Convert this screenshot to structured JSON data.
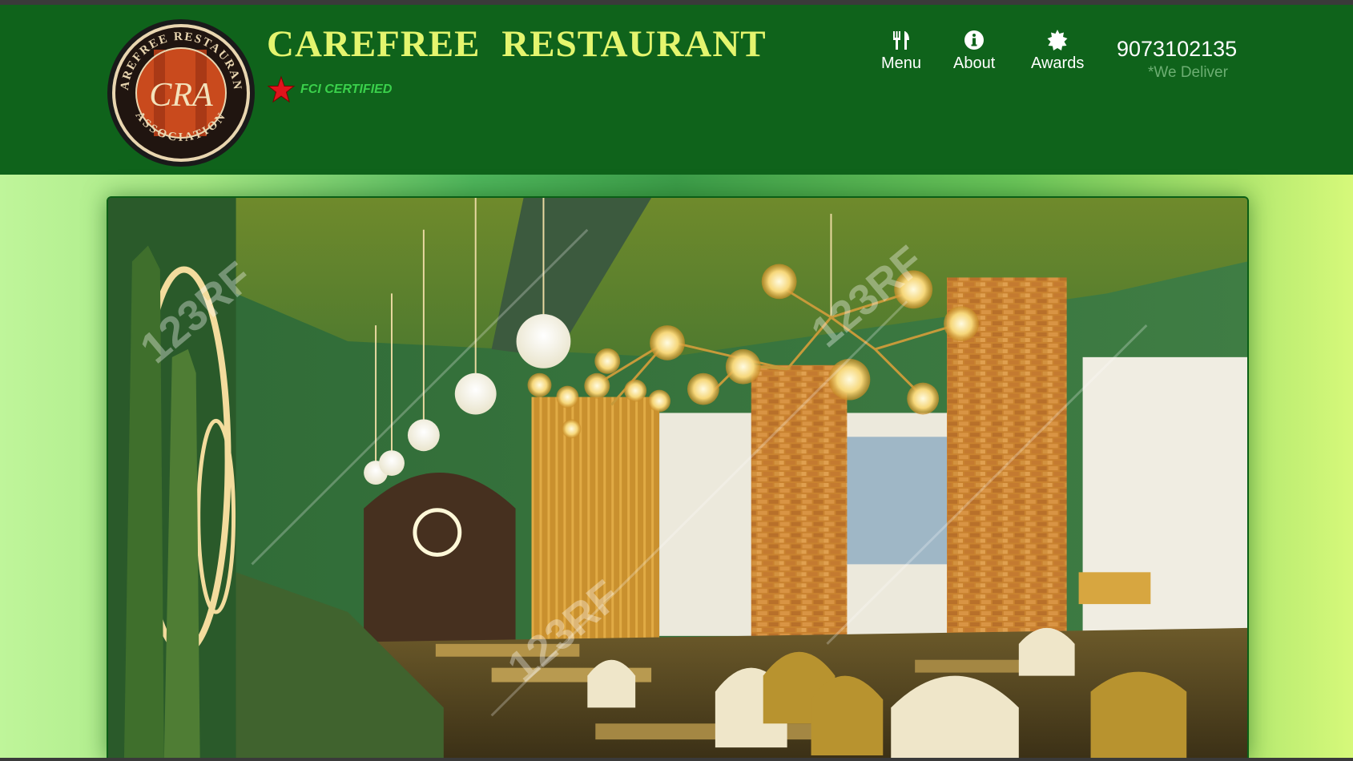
{
  "header": {
    "title": "CAREFREE  RESTAURANT",
    "certification": "FCI CERTIFIED",
    "phone": "9073102135",
    "delivery_note": "*We Deliver",
    "logo": {
      "top_text": "CAREFREE RESTAURANT",
      "bottom_text": "ASSOCIATION",
      "monogram": "CRA"
    }
  },
  "nav": {
    "items": [
      {
        "label": "Menu",
        "icon": "cutlery-icon"
      },
      {
        "label": "About",
        "icon": "info-icon"
      },
      {
        "label": "Awards",
        "icon": "badge-icon"
      }
    ]
  },
  "hero": {
    "watermark": "123RF",
    "image": "restaurant-interior"
  },
  "colors": {
    "header_bg": "#0f631b",
    "title": "#e4f56e",
    "cert_text": "#3ad04b",
    "star": "#e0141c"
  }
}
